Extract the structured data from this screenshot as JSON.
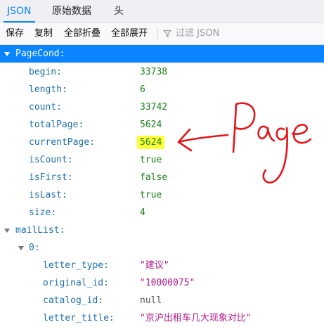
{
  "tabs": [
    {
      "label": "JSON"
    },
    {
      "label": "原始数据"
    },
    {
      "label": "头"
    }
  ],
  "toolbar": {
    "save": "保存",
    "copy": "复制",
    "collapse_all": "全部折叠",
    "expand_all": "全部展开",
    "filter": "过滤 JSON"
  },
  "tree": {
    "pagecond_key": "PageCond:",
    "pagecond": [
      {
        "key": "begin:",
        "value": "33738",
        "type": "number"
      },
      {
        "key": "length:",
        "value": "6",
        "type": "number"
      },
      {
        "key": "count:",
        "value": "33742",
        "type": "number"
      },
      {
        "key": "totalPage:",
        "value": "5624",
        "type": "number"
      },
      {
        "key": "currentPage:",
        "value": "5624",
        "type": "number"
      },
      {
        "key": "isCount:",
        "value": "true",
        "type": "boolean"
      },
      {
        "key": "isFirst:",
        "value": "false",
        "type": "boolean"
      },
      {
        "key": "isLast:",
        "value": "true",
        "type": "boolean"
      },
      {
        "key": "size:",
        "value": "4",
        "type": "number"
      }
    ],
    "maillist_key": "mailList:",
    "item0_key": "0:",
    "item0": [
      {
        "key": "letter_type:",
        "value": "\"建议\"",
        "type": "string"
      },
      {
        "key": "original_id:",
        "value": "\"10000075\"",
        "type": "string"
      },
      {
        "key": "catalog_id:",
        "value": "null",
        "type": "null"
      },
      {
        "key": "letter_title:",
        "value": "\"京沪出租车几大现象对比\"",
        "type": "string"
      }
    ]
  },
  "annotation": {
    "color": "#e8141a",
    "highlight_color": "#ffff3a",
    "highlighted_key": "currentPage"
  },
  "colors": {
    "accent": "#0a84ff",
    "key": "#1d6fae",
    "number": "#1a7f1a",
    "string": "#b0198a"
  }
}
